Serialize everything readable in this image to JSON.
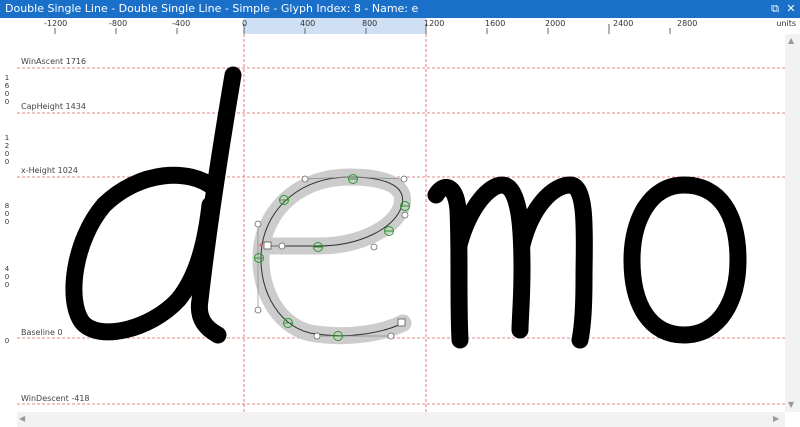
{
  "window": {
    "title": "Double Single Line - Double Single Line - Simple - Glyph Index: 8 - Name: e",
    "restore_glyph": "⧉",
    "close_glyph": "✕"
  },
  "ruler_top": {
    "ticks": [
      "-1200",
      "-800",
      "-400",
      "0",
      "400",
      "800",
      "1200",
      "1600",
      "2000",
      "2400",
      "2800"
    ],
    "units_label": "units"
  },
  "ruler_left": {
    "labels": [
      "1600",
      "1200",
      "800",
      "400",
      "0"
    ]
  },
  "metrics": {
    "win_ascent": "WinAscent 1716",
    "cap_height": "CapHeight 1434",
    "x_height": "x-Height 1024",
    "baseline": "Baseline 0",
    "win_descent": "WinDescent -418"
  },
  "glyphs": {
    "text": "demo",
    "selected": "e",
    "glyph_index": 8,
    "stroke_color": "#000000",
    "highlight_color": "#cccccc",
    "guide_color": "#e06060",
    "point_color": "#2a9a2a"
  },
  "scrollbars": {
    "up_arrow": "▲",
    "down_arrow": "▼",
    "left_arrow": "◀",
    "right_arrow": "▶"
  }
}
